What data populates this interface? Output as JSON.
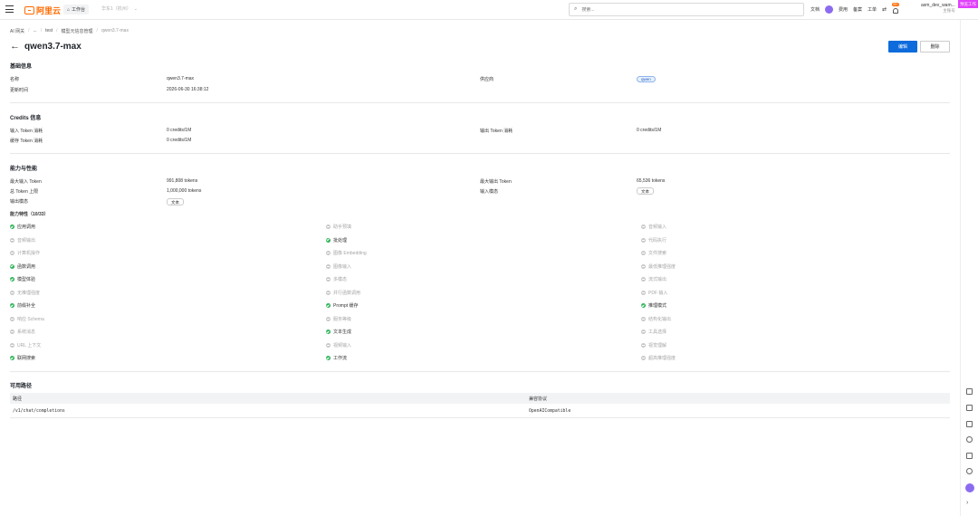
{
  "topbar": {
    "logo": "阿里云",
    "workbench": "工作台",
    "region": "华东1（杭州）",
    "search_placeholder": "搜索...",
    "links": [
      "文档",
      "费用",
      "备案",
      "工单"
    ],
    "badge_count": "99+",
    "user_name": "asm_dev_wam...",
    "user_sub": "主账号",
    "corner_badge": "预览工作"
  },
  "breadcrumb": [
    "AI 网关",
    "...",
    "test",
    "模型元信息管理",
    "qwen3.7-max"
  ],
  "page": {
    "title": "qwen3.7-max",
    "edit": "编辑",
    "delete": "删除"
  },
  "basic": {
    "title": "基础信息",
    "name_label": "名称",
    "name_value": "qwen3.7-max",
    "provider_label": "供应商",
    "provider_value": "qwen",
    "updated_label": "更新时间",
    "updated_value": "2026-06-30 16:38:12"
  },
  "credits": {
    "title": "Credits 信息",
    "input_label": "输入 Token 消耗",
    "input_value": "0 credits/1M",
    "output_label": "输出 Token 消耗",
    "output_value": "0 credits/1M",
    "cache_label": "缓存 Token 消耗",
    "cache_value": "0 credits/1M"
  },
  "capability": {
    "title": "能力与性能",
    "max_input_label": "最大输入 Token",
    "max_input_value": "991,808 tokens",
    "max_output_label": "最大输出 Token",
    "max_output_value": "65,536 tokens",
    "total_label": "总 Token 上限",
    "total_value": "1,000,000 tokens",
    "input_modal_label": "输入模态",
    "input_modal_value": "文本",
    "output_modal_label": "输出模态",
    "output_modal_value": "文本",
    "features_label": "能力特性（10/33）",
    "features": [
      {
        "label": "应用调用",
        "on": true
      },
      {
        "label": "助手预填",
        "on": false
      },
      {
        "label": "音频输入",
        "on": false
      },
      {
        "label": "音频输出",
        "on": false
      },
      {
        "label": "批处理",
        "on": true
      },
      {
        "label": "代码执行",
        "on": false
      },
      {
        "label": "计算机操作",
        "on": false
      },
      {
        "label": "图像 Embedding",
        "on": false
      },
      {
        "label": "文件搜索",
        "on": false
      },
      {
        "label": "函数调用",
        "on": true
      },
      {
        "label": "图像输入",
        "on": false
      },
      {
        "label": "最低推理强度",
        "on": false
      },
      {
        "label": "模型体验",
        "on": true
      },
      {
        "label": "多模态",
        "on": false
      },
      {
        "label": "流式输出",
        "on": false
      },
      {
        "label": "无推理强度",
        "on": false
      },
      {
        "label": "并行函数调用",
        "on": false
      },
      {
        "label": "PDF 输入",
        "on": false
      },
      {
        "label": "前缀补全",
        "on": true
      },
      {
        "label": "Prompt 缓存",
        "on": true
      },
      {
        "label": "推理模式",
        "on": true
      },
      {
        "label": "响应 Schema",
        "on": false
      },
      {
        "label": "服务等级",
        "on": false
      },
      {
        "label": "结构化输出",
        "on": false
      },
      {
        "label": "系统消息",
        "on": false
      },
      {
        "label": "文本生成",
        "on": true
      },
      {
        "label": "工具选择",
        "on": false
      },
      {
        "label": "URL 上下文",
        "on": false
      },
      {
        "label": "视频输入",
        "on": false
      },
      {
        "label": "视觉理解",
        "on": false
      },
      {
        "label": "联网搜索",
        "on": true
      },
      {
        "label": "工作流",
        "on": true
      },
      {
        "label": "超高推理强度",
        "on": false
      }
    ]
  },
  "routes": {
    "title": "可用路径",
    "col_path": "路径",
    "col_protocol": "兼容协议",
    "rows": [
      {
        "path": "/v1/chat/completions",
        "protocol": "OpenAICompatible"
      }
    ]
  },
  "colors": {
    "primary": "#0d6bdc",
    "brand": "#ff6a00",
    "enabled": "#2eb35a",
    "disabled": "#c8c8c8"
  }
}
